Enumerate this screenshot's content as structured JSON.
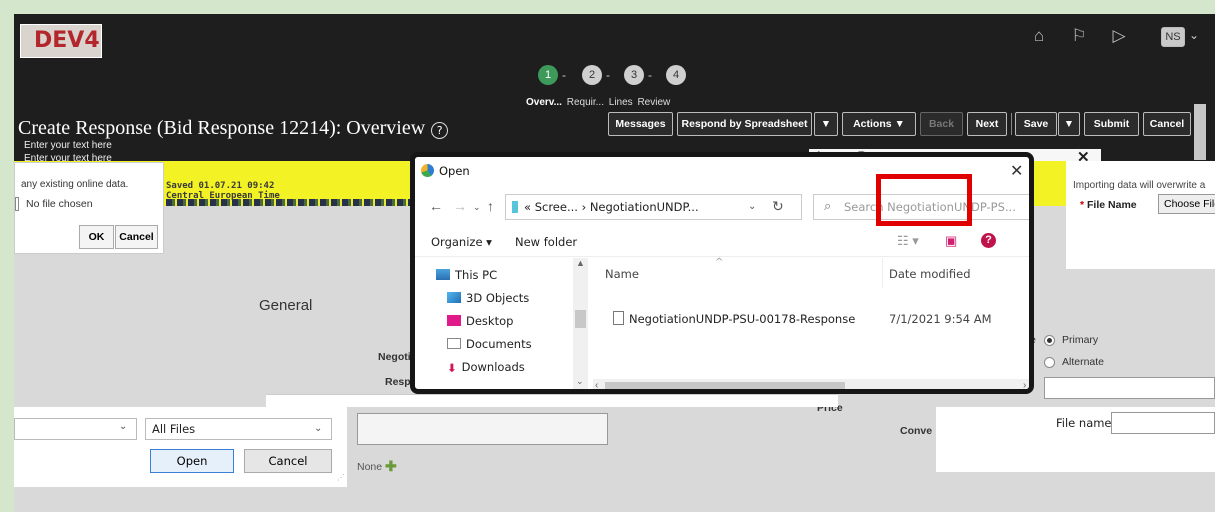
{
  "env": {
    "label": "DEV4"
  },
  "user": {
    "initials": "NS"
  },
  "icons": {
    "home": "home-icon",
    "flag": "flag-icon",
    "notifications": "notification-icon"
  },
  "train": {
    "steps": [
      "1",
      "2",
      "3",
      "4"
    ],
    "labels": [
      "Overv...",
      "Requir...",
      "Lines",
      "Review"
    ]
  },
  "page": {
    "title": "Create Response (Bid Response 12214): Overview",
    "hint1": "Enter your text here",
    "hint2": "Enter your text here"
  },
  "toolbar": {
    "messages": "Messages",
    "respond_by_spreadsheet": "Respond by Spreadsheet",
    "actions": "Actions",
    "back": "Back",
    "next": "Next",
    "save": "Save",
    "submit": "Submit",
    "cancel": "Cancel"
  },
  "import_response": {
    "title": "Import Response",
    "warning": "Importing data will overwrite a",
    "file_name_label": "File Name",
    "choose_file": "Choose File"
  },
  "saved_banner": {
    "line1": "Saved 01.07.21 09:42",
    "line2": "Central European Time"
  },
  "left_dialog": {
    "message": "any existing online data.",
    "no_file": "No file chosen",
    "ok": "OK",
    "cancel": "Cancel"
  },
  "form": {
    "section": "General",
    "negotiation": "Negotiation",
    "response": "Response",
    "price": "Price",
    "conversion": "Conve",
    "primary": "Primary",
    "alternate": "Alternate",
    "none": "None"
  },
  "open_dialog": {
    "title": "Open",
    "address": [
      "« Scree...",
      "›",
      "NegotiationUNDP..."
    ],
    "search_placeholder": "Search NegotiationUNDP-PS...",
    "organize": "Organize",
    "new_folder": "New folder",
    "tree": [
      "This PC",
      "3D Objects",
      "Desktop",
      "Documents",
      "Downloads"
    ],
    "columns": {
      "name": "Name",
      "date": "Date modified"
    },
    "files": [
      {
        "name": "NegotiationUNDP-PSU-00178-Response",
        "date": "7/1/2021 9:54 AM"
      }
    ],
    "filter": "All Files",
    "open": "Open",
    "cancel": "Cancel"
  },
  "file_name_panel": {
    "label": "File name:"
  }
}
